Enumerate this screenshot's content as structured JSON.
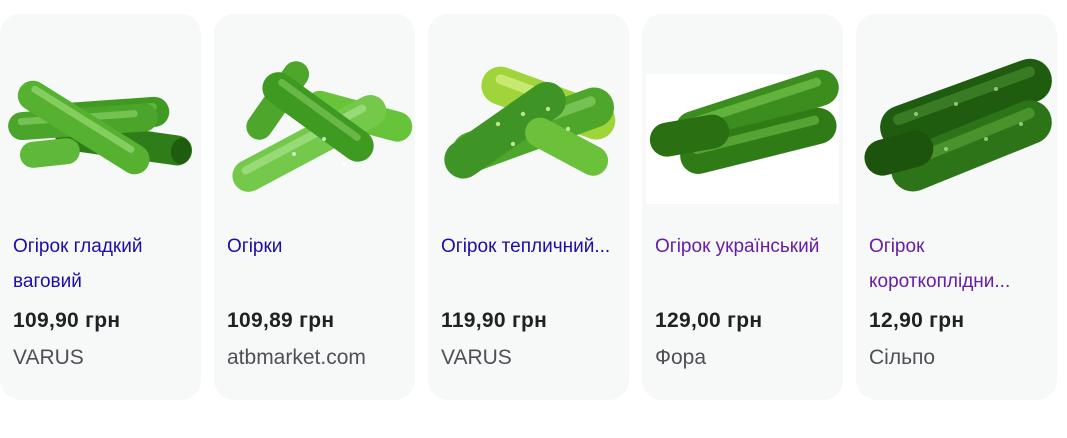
{
  "products": [
    {
      "title": "Огірок гладкий ваговий",
      "price": "109,90 грн",
      "merchant": "VARUS",
      "image_icon": "cucumber-image",
      "link_color": "#1a0dab"
    },
    {
      "title": "Огірки",
      "price": "109,89 грн",
      "merchant": "atbmarket.com",
      "image_icon": "cucumber-image",
      "link_color": "#1a0dab"
    },
    {
      "title": "Огірок тепличний...",
      "price": "119,90 грн",
      "merchant": "VARUS",
      "image_icon": "cucumber-image",
      "link_color": "#1a0dab"
    },
    {
      "title": "Огірок український",
      "price": "129,00 грн",
      "merchant": "Фора",
      "image_icon": "cucumber-image",
      "link_color": "#681da8"
    },
    {
      "title": "Огірок короткоплідни...",
      "price": "12,90 грн",
      "merchant": "Сільпо",
      "image_icon": "cucumber-image",
      "link_color": "#681da8"
    }
  ]
}
